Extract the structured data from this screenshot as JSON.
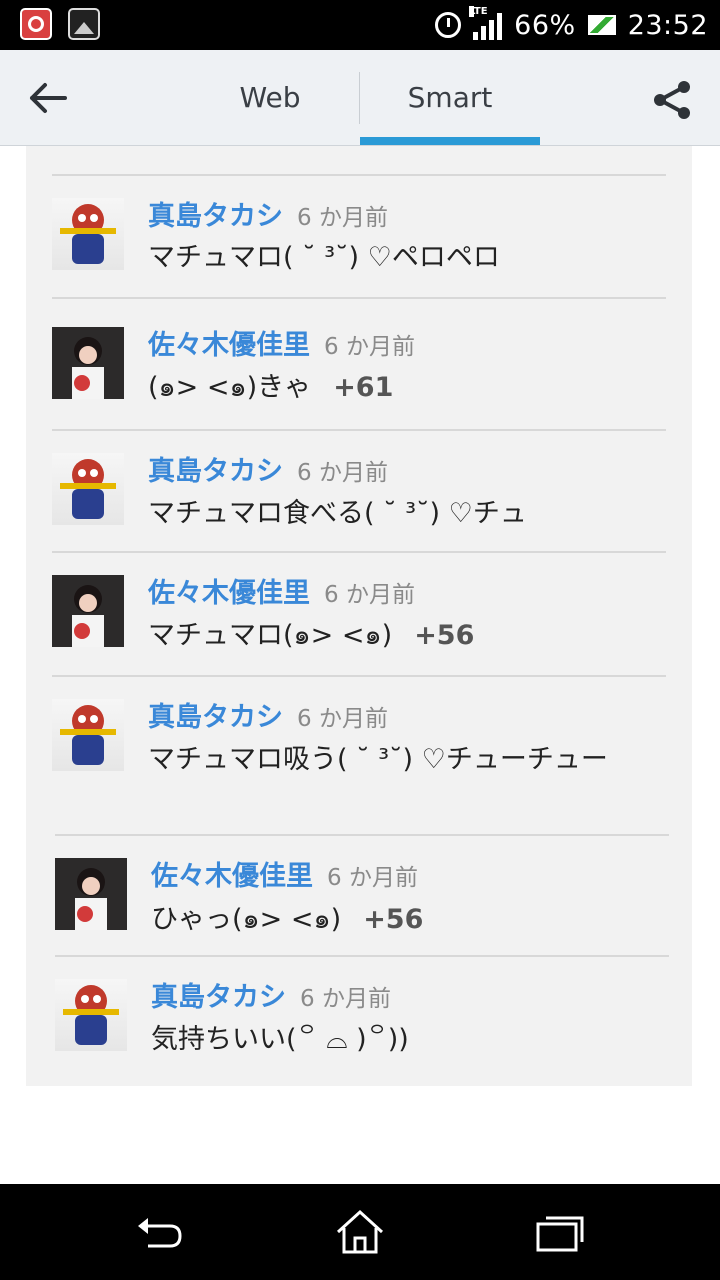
{
  "status_bar": {
    "network": "LTE",
    "battery_percent": "66%",
    "time": "23:52",
    "icons": [
      "app-icon",
      "gallery-icon",
      "alarm-icon",
      "signal-icon",
      "battery-icon"
    ]
  },
  "tabs": [
    {
      "label": "Web",
      "selected": false
    },
    {
      "label": "Smart",
      "selected": true
    }
  ],
  "toolbar": {
    "back_icon": "arrow-left-icon",
    "share_icon": "share-icon"
  },
  "comments": [
    {
      "user": "真島タカシ",
      "time": "6 か月前",
      "text": "マチュマロ( ˘ ³˘) ♡ペロペロ",
      "plus": "",
      "avatar": "mascot"
    },
    {
      "user": "佐々木優佳里",
      "time": "6 か月前",
      "text": "(๑> <๑)きゃ",
      "plus": "+61",
      "avatar": "girl"
    },
    {
      "user": "真島タカシ",
      "time": "6 か月前",
      "text": "マチュマロ食べる( ˘ ³˘) ♡チュ",
      "plus": "",
      "avatar": "mascot"
    },
    {
      "user": "佐々木優佳里",
      "time": "6 か月前",
      "text": "マチュマロ(๑> <๑)",
      "plus": "+56",
      "avatar": "girl"
    },
    {
      "user": "真島タカシ",
      "time": "6 か月前",
      "text": "マチュマロ吸う( ˘ ³˘) ♡チューチュー",
      "plus": "",
      "avatar": "mascot"
    },
    {
      "user": "佐々木優佳里",
      "time": "6 か月前",
      "text": "ひゃっ(๑> <๑)",
      "plus": "+56",
      "avatar": "girl"
    },
    {
      "user": "真島タカシ",
      "time": "6 か月前",
      "text": "気持ちいい(꒪ ⌓ )꒪))",
      "plus": "",
      "avatar": "mascot"
    }
  ],
  "nav_bar": {
    "icons": [
      "back-nav-icon",
      "home-icon",
      "recent-apps-icon"
    ]
  },
  "colors": {
    "accent": "#2a9ad6",
    "username": "#3a88d8",
    "card_bg": "#f2f2f2"
  }
}
